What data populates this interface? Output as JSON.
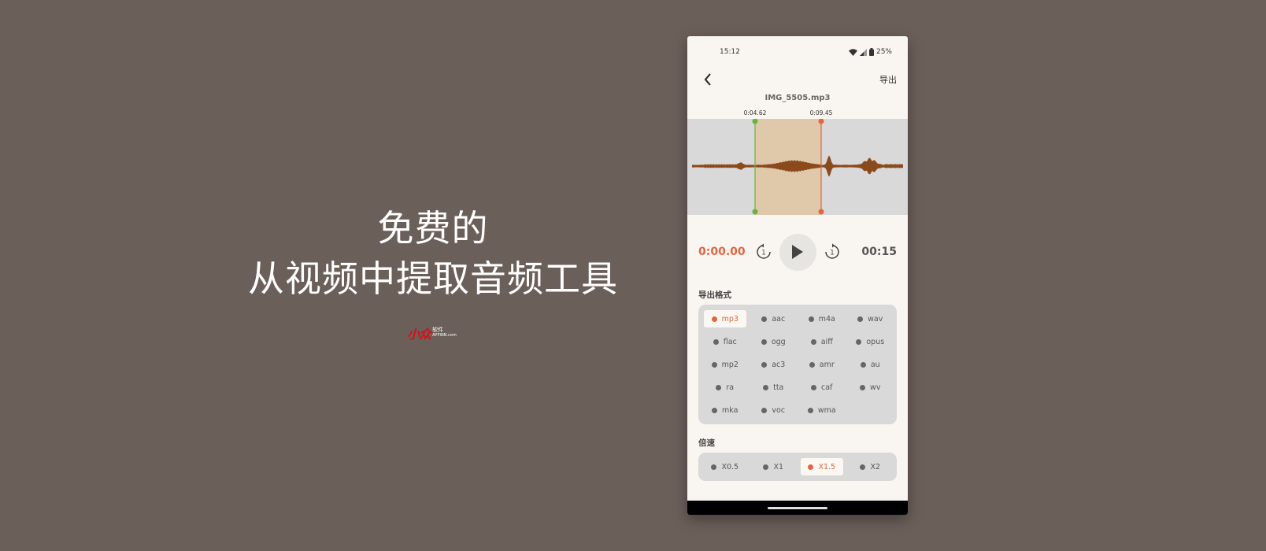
{
  "headline": {
    "line1": "免费的",
    "line2": "从视频中提取音频工具"
  },
  "brand": {
    "mark": "小众",
    "cn": "软件",
    "site": "APPINN.com"
  },
  "status_bar": {
    "time": "15:12",
    "battery": "25%"
  },
  "app_bar": {
    "export_label": "导出"
  },
  "file_name": "IMG_5505.mp3",
  "selection": {
    "start_label": "0:04.62",
    "end_label": "0:09.45"
  },
  "player": {
    "current_time": "0:00.00",
    "total_time": "00:15",
    "skip_back_label": "1",
    "skip_forward_label": "1"
  },
  "format": {
    "label": "导出格式",
    "options": [
      "mp3",
      "aac",
      "m4a",
      "wav",
      "flac",
      "ogg",
      "aiff",
      "opus",
      "mp2",
      "ac3",
      "amr",
      "au",
      "ra",
      "tta",
      "caf",
      "wv",
      "mka",
      "voc",
      "wma"
    ],
    "selected": "mp3"
  },
  "speed": {
    "label": "倍速",
    "options": [
      "X0.5",
      "X1",
      "X1.5",
      "X2"
    ],
    "selected": "X1.5"
  },
  "colors": {
    "accent": "#e4653f",
    "start_marker": "#6ab23e",
    "end_marker": "#e4653f",
    "waveform": "#8b4a1c",
    "selection_fill": "#e0c8ab",
    "page_bg": "#6b5f59",
    "phone_bg": "#f9f6f1"
  }
}
